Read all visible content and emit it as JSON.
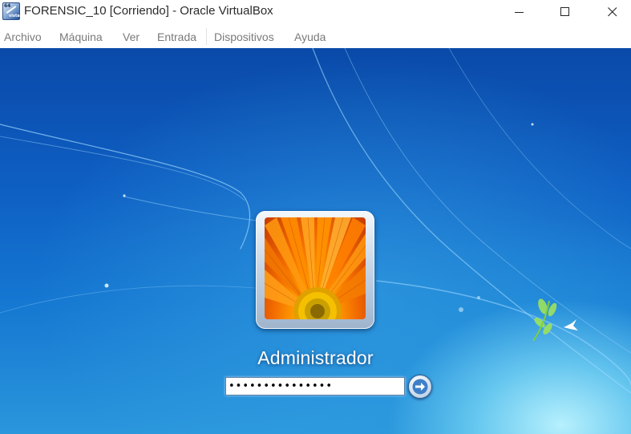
{
  "window": {
    "title": "FORENSIC_10 [Corriendo] - Oracle VirtualBox",
    "app_icon": "virtualbox-icon",
    "app_icon_text_top": "64",
    "app_icon_text_bottom": "vista"
  },
  "menu": {
    "items": [
      {
        "label": "Archivo"
      },
      {
        "label": "Máquina"
      },
      {
        "label": "Ver"
      },
      {
        "label": "Entrada"
      },
      {
        "label": "Dispositivos"
      },
      {
        "label": "Ayuda"
      }
    ]
  },
  "login": {
    "username": "Administrador",
    "password_mask": "•••••••••••••••",
    "submit_icon": "arrow-right-icon",
    "avatar": "orange-flower-avatar"
  },
  "colors": {
    "desktop_top": "#0a4aa9",
    "desktop_glow": "#bef5ff",
    "menu_text": "#7a7a7a",
    "title_text": "#2b2b2b"
  }
}
